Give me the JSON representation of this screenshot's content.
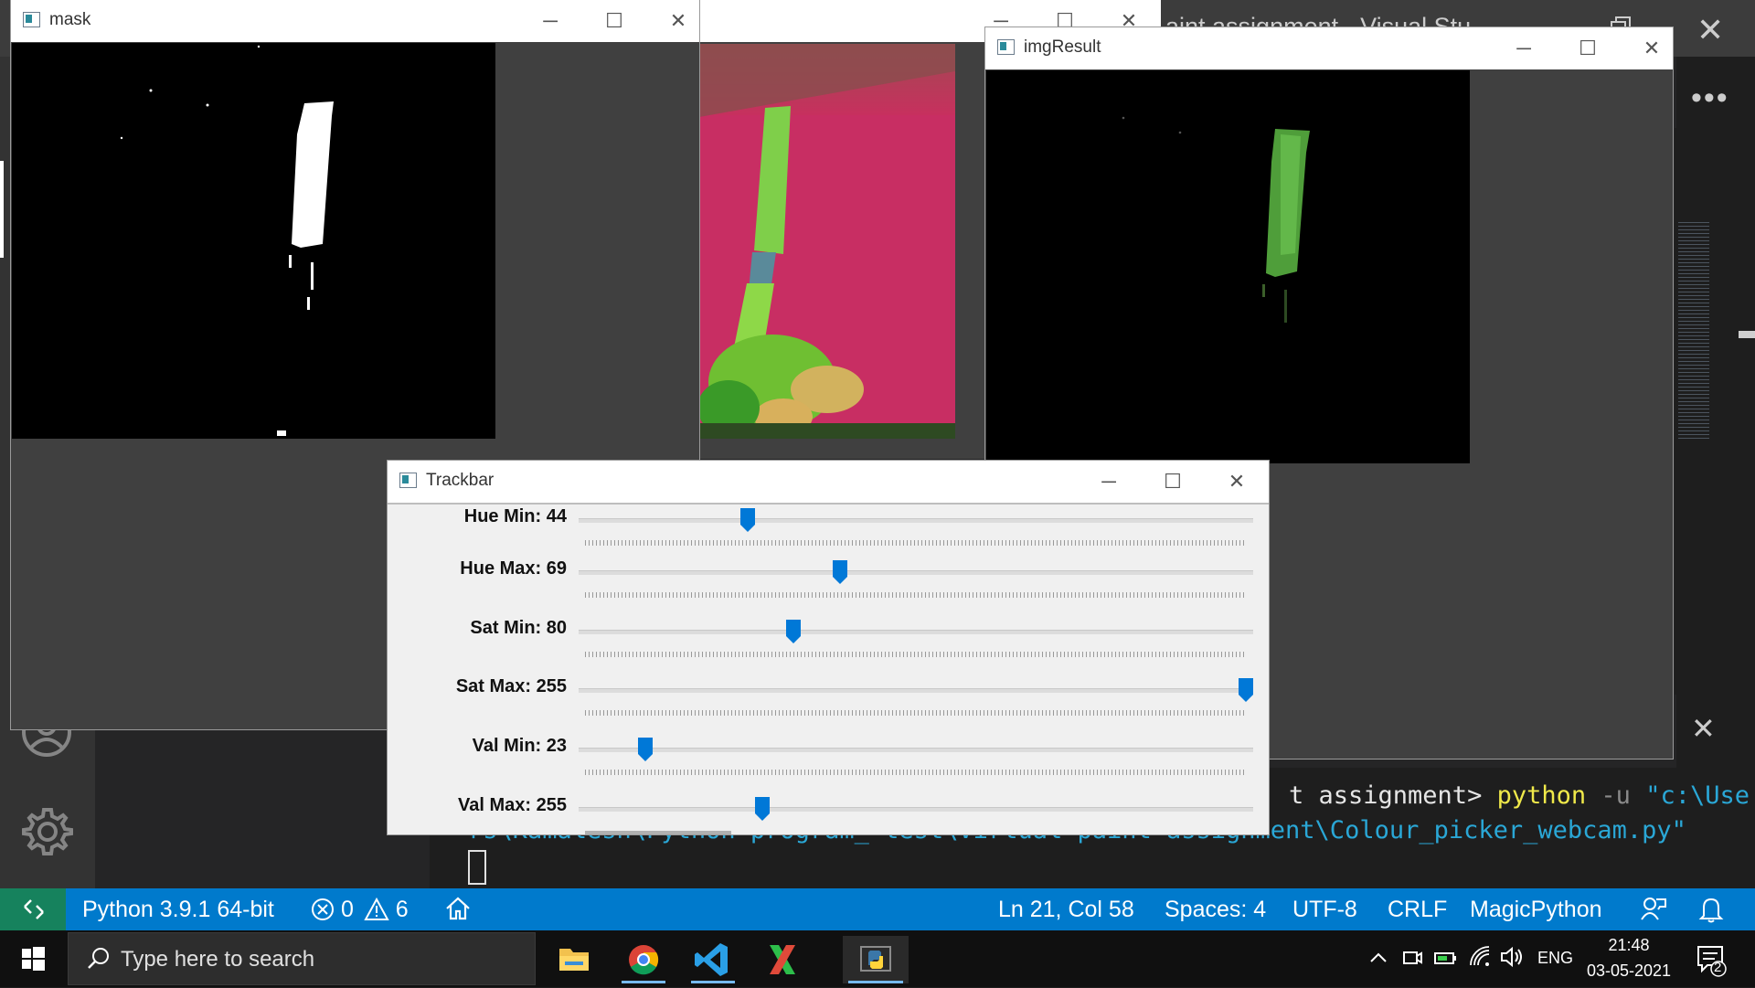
{
  "vscode": {
    "title": "aint assignment - Visual Stu",
    "more_label": "•••",
    "terminal": {
      "prompt_tail": "t assignment>",
      "command": "python",
      "flag": "-u",
      "path_part1": "\"c:\\Use",
      "path_part2": "rs\\Kamalesh\\Python program_ test\\Virtual paint assignment\\Colour_picker_webcam.py\""
    },
    "statusbar": {
      "python": "Python 3.9.1 64-bit",
      "errors": "0",
      "warnings": "6",
      "position": "Ln 21, Col 58",
      "spaces": "Spaces: 4",
      "encoding": "UTF-8",
      "eol": "CRLF",
      "language": "MagicPython"
    }
  },
  "windows": {
    "mask": {
      "title": "mask"
    },
    "result": {
      "title": "imgResult"
    },
    "trackbar": {
      "title": "Trackbar",
      "sliders": [
        {
          "label": "Hue Min: 44",
          "value": 44,
          "max": 179
        },
        {
          "label": "Hue Max: 69",
          "value": 69,
          "max": 179
        },
        {
          "label": "Sat Min: 80",
          "value": 80,
          "max": 255
        },
        {
          "label": "Sat Max: 255",
          "value": 255,
          "max": 255
        },
        {
          "label": "Val Min: 23",
          "value": 23,
          "max": 255
        },
        {
          "label": "Val Max: 255",
          "value": 255,
          "max": 255
        }
      ]
    }
  },
  "taskbar": {
    "search_placeholder": "Type here to search",
    "language": "ENG",
    "time": "21:48",
    "date": "03-05-2021",
    "notification_count": "2"
  },
  "colors": {
    "statusbar": "#007acc",
    "remote": "#16825d",
    "slider_thumb": "#0078d7"
  }
}
